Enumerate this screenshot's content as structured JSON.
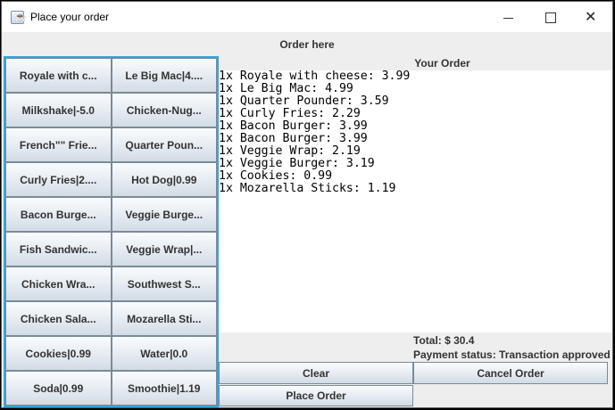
{
  "window": {
    "title": "Place your order",
    "icon": "java-cup-icon"
  },
  "header": {
    "order_here": "Order here"
  },
  "menu": {
    "items": [
      {
        "label": "Royale with c..."
      },
      {
        "label": "Le Big Mac|4...."
      },
      {
        "label": "Milkshake|-5.0"
      },
      {
        "label": "Chicken-Nug..."
      },
      {
        "label": "French\"\" Frie..."
      },
      {
        "label": "Quarter Poun..."
      },
      {
        "label": "Curly Fries|2...."
      },
      {
        "label": "Hot Dog|0.99"
      },
      {
        "label": "Bacon Burge..."
      },
      {
        "label": "Veggie Burge..."
      },
      {
        "label": "Fish Sandwic..."
      },
      {
        "label": "Veggie Wrap|..."
      },
      {
        "label": "Chicken Wra..."
      },
      {
        "label": "Southwest S..."
      },
      {
        "label": "Chicken Sala..."
      },
      {
        "label": "Mozarella Sti..."
      },
      {
        "label": "Cookies|0.99"
      },
      {
        "label": "Water|0.0"
      },
      {
        "label": "Soda|0.99"
      },
      {
        "label": "Smoothie|1.19"
      }
    ]
  },
  "order": {
    "title": "Your Order",
    "lines": [
      "1x Royale with cheese: 3.99",
      "1x Le Big Mac: 4.99",
      "1x Quarter Pounder: 3.59",
      "1x Curly Fries: 2.29",
      "1x Bacon Burger: 3.99",
      "1x Bacon Burger: 3.99",
      "1x Veggie Wrap: 2.19",
      "1x Veggie Burger: 3.19",
      "1x Cookies: 0.99",
      "1x Mozarella Sticks: 1.19"
    ],
    "total": "Total: $ 30.4",
    "payment_status": "Payment status: Transaction approved"
  },
  "actions": {
    "clear": "Clear",
    "cancel": "Cancel Order",
    "place": "Place Order"
  }
}
